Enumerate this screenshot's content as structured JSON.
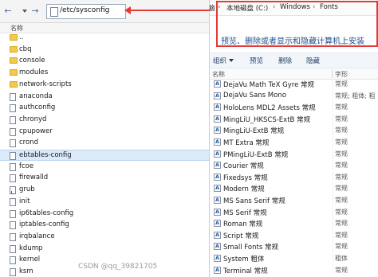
{
  "left_pane": {
    "path": "/etc/sysconfig",
    "column_name": "名称",
    "items": [
      {
        "name": "..",
        "icon": "folder"
      },
      {
        "name": "cbq",
        "icon": "folder"
      },
      {
        "name": "console",
        "icon": "folder"
      },
      {
        "name": "modules",
        "icon": "folder"
      },
      {
        "name": "network-scripts",
        "icon": "folder"
      },
      {
        "name": "anaconda",
        "icon": "file"
      },
      {
        "name": "authconfig",
        "icon": "file"
      },
      {
        "name": "chronyd",
        "icon": "file"
      },
      {
        "name": "cpupower",
        "icon": "file"
      },
      {
        "name": "crond",
        "icon": "file"
      },
      {
        "name": "ebtables-config",
        "icon": "file",
        "selected": true
      },
      {
        "name": "fcoe",
        "icon": "file"
      },
      {
        "name": "firewalld",
        "icon": "file"
      },
      {
        "name": "grub",
        "icon": "link"
      },
      {
        "name": "init",
        "icon": "file"
      },
      {
        "name": "ip6tables-config",
        "icon": "file"
      },
      {
        "name": "iptables-config",
        "icon": "file"
      },
      {
        "name": "irqbalance",
        "icon": "file"
      },
      {
        "name": "kdump",
        "icon": "file"
      },
      {
        "name": "kernel",
        "icon": "file"
      },
      {
        "name": "ksm",
        "icon": "file"
      }
    ]
  },
  "right_pane": {
    "breadcrumb": {
      "prefix": "脑",
      "sep": "›",
      "drive": "本地磁盘 (C:)",
      "windows": "Windows",
      "fonts": "Fonts"
    },
    "heading": "预览、删除或者显示和隐藏计算机上安装",
    "commands": {
      "organize": "组织",
      "preview": "预览",
      "delete": "删除",
      "hide": "隐藏"
    },
    "columns": {
      "name": "名称",
      "style": "字形"
    },
    "fonts": [
      {
        "name": "DejaVu Math TeX Gyre 常规",
        "style": "常规"
      },
      {
        "name": "DejaVu Sans Mono",
        "style": "常规; 粗体; 粗"
      },
      {
        "name": "HoloLens MDL2 Assets 常规",
        "style": "常规"
      },
      {
        "name": "MingLiU_HKSCS-ExtB 常规",
        "style": "常规"
      },
      {
        "name": "MingLiU-ExtB 常规",
        "style": "常规"
      },
      {
        "name": "MT Extra 常规",
        "style": "常规"
      },
      {
        "name": "PMingLiU-ExtB 常规",
        "style": "常规"
      },
      {
        "name": "Courier 常规",
        "style": "常规"
      },
      {
        "name": "Fixedsys 常规",
        "style": "常规"
      },
      {
        "name": "Modern 常规",
        "style": "常规"
      },
      {
        "name": "MS Sans Serif 常规",
        "style": "常规"
      },
      {
        "name": "MS Serif 常规",
        "style": "常规"
      },
      {
        "name": "Roman 常规",
        "style": "常规"
      },
      {
        "name": "Script 常规",
        "style": "常规"
      },
      {
        "name": "Small Fonts 常规",
        "style": "常规"
      },
      {
        "name": "System 粗体",
        "style": "粗体"
      },
      {
        "name": "Terminal 常规",
        "style": "常规"
      }
    ]
  },
  "watermark": "CSDN @qq_39821705",
  "colors": {
    "annotation_red": "#e53935",
    "selection": "#dbeaf9",
    "heading_blue": "#1e4e8c"
  }
}
